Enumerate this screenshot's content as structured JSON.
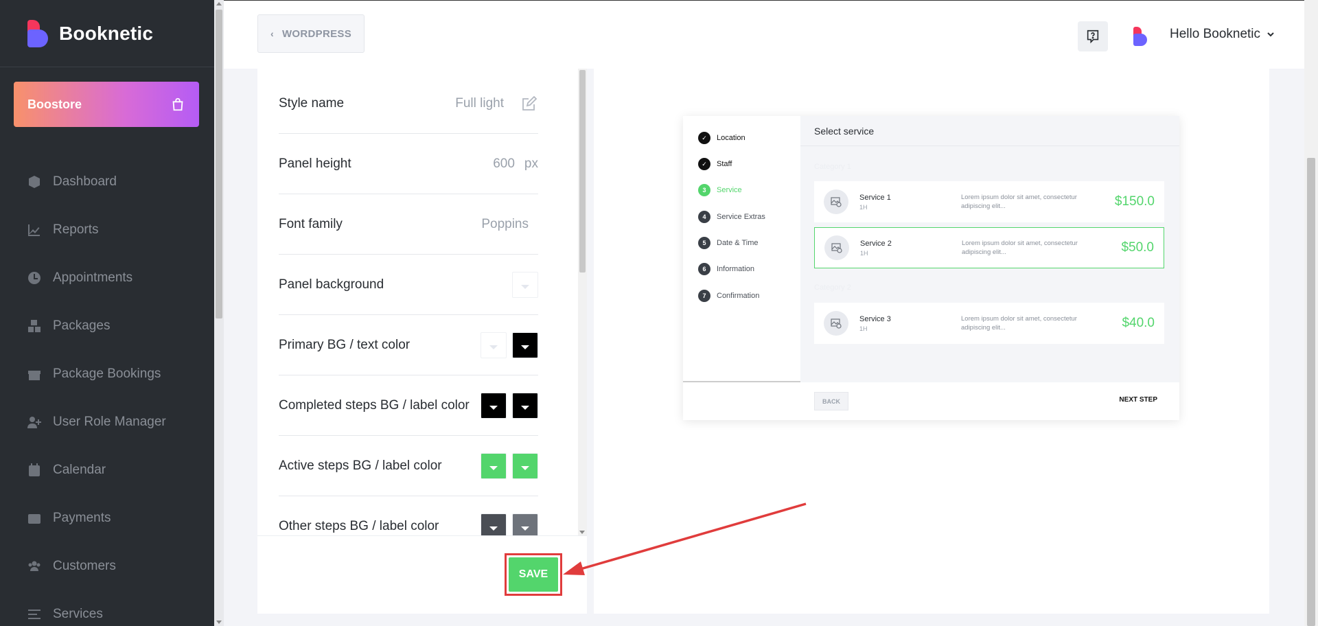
{
  "brand": {
    "name": "Booknetic"
  },
  "boostore": {
    "label": "Boostore"
  },
  "nav": [
    {
      "label": "Dashboard",
      "icon": "cube-icon"
    },
    {
      "label": "Reports",
      "icon": "chart-icon"
    },
    {
      "label": "Appointments",
      "icon": "clock-icon"
    },
    {
      "label": "Packages",
      "icon": "boxes-icon"
    },
    {
      "label": "Package Bookings",
      "icon": "gift-icon"
    },
    {
      "label": "User Role Manager",
      "icon": "user-plus-icon"
    },
    {
      "label": "Calendar",
      "icon": "calendar-icon"
    },
    {
      "label": "Payments",
      "icon": "wallet-icon"
    },
    {
      "label": "Customers",
      "icon": "users-icon"
    },
    {
      "label": "Services",
      "icon": "list-icon"
    }
  ],
  "header": {
    "back_label": "WORDPRESS",
    "user_name": "Hello Booknetic"
  },
  "settings": {
    "style_name": {
      "label": "Style name",
      "value": "Full light"
    },
    "panel_height": {
      "label": "Panel height",
      "value": "600",
      "unit": "px"
    },
    "font_family": {
      "label": "Font family",
      "value": "Poppins"
    },
    "panel_background": {
      "label": "Panel background",
      "color": "#ffffff"
    },
    "primary": {
      "label": "Primary BG / text color",
      "colors": [
        "#ffffff",
        "#000000"
      ]
    },
    "completed": {
      "label": "Completed steps BG / label color",
      "colors": [
        "#000000",
        "#000000"
      ]
    },
    "active": {
      "label": "Active steps BG / label color",
      "colors": [
        "#53d56c",
        "#53d56c"
      ]
    },
    "other": {
      "label": "Other steps BG / label color",
      "colors": [
        "#4a4e55",
        "#6e737b"
      ]
    },
    "save_label": "SAVE"
  },
  "preview": {
    "steps": [
      {
        "num": "1",
        "label": "Location",
        "state": "done"
      },
      {
        "num": "2",
        "label": "Staff",
        "state": "done"
      },
      {
        "num": "3",
        "label": "Service",
        "state": "active"
      },
      {
        "num": "4",
        "label": "Service Extras",
        "state": "pending"
      },
      {
        "num": "5",
        "label": "Date & Time",
        "state": "pending"
      },
      {
        "num": "6",
        "label": "Information",
        "state": "pending"
      },
      {
        "num": "7",
        "label": "Confirmation",
        "state": "pending"
      }
    ],
    "title": "Select service",
    "category1": "Category 1",
    "category2": "Category 2",
    "services": [
      {
        "name": "Service 1",
        "duration": "1H",
        "desc": "Lorem ipsum dolor sit amet, consectetur adipiscing elit...",
        "price": "$150.0"
      },
      {
        "name": "Service 2",
        "duration": "1H",
        "desc": "Lorem ipsum dolor sit amet, consectetur adipiscing elit...",
        "price": "$50.0"
      },
      {
        "name": "Service 3",
        "duration": "1H",
        "desc": "Lorem ipsum dolor sit amet, consectetur adipiscing elit...",
        "price": "$40.0"
      }
    ],
    "back_label": "BACK",
    "next_label": "NEXT STEP"
  },
  "colors": {
    "accent_green": "#53d56c",
    "sidebar_bg": "#292d32",
    "annotation_red": "#e03c3c"
  }
}
